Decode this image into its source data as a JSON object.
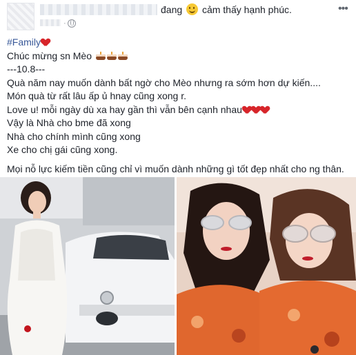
{
  "header": {
    "activity_prefix": "đang",
    "activity_suffix": "cảm thấy hạnh phúc.",
    "more_icon": "more-horizontal-icon"
  },
  "post": {
    "hashtag": "#Family",
    "lines": [
      "Chúc mừng sn Mèo",
      "---10.8---",
      "Quà năm nay muốn dành bất ngờ cho Mèo nhưng ra sớm hơn dự kiến....",
      "Món quà từ rất lâu ấp ủ hnay cũng xong r.",
      "Love u! mỗi ngày dù xa hay gần thì vẫn bên cạnh nhau",
      "Vậy là Nhà cho bme đã xong",
      "Nhà cho chính mình cũng xong",
      "Xe cho chị gái cũng xong.",
      "Mọi nỗ lực kiếm tiền cũng chỉ vì muốn dành những gì tốt đẹp nhất cho ng thân."
    ]
  },
  "colors": {
    "text": "#1d2129",
    "hashtag": "#385898",
    "heart": "#d7252a",
    "muted": "#90949c"
  }
}
